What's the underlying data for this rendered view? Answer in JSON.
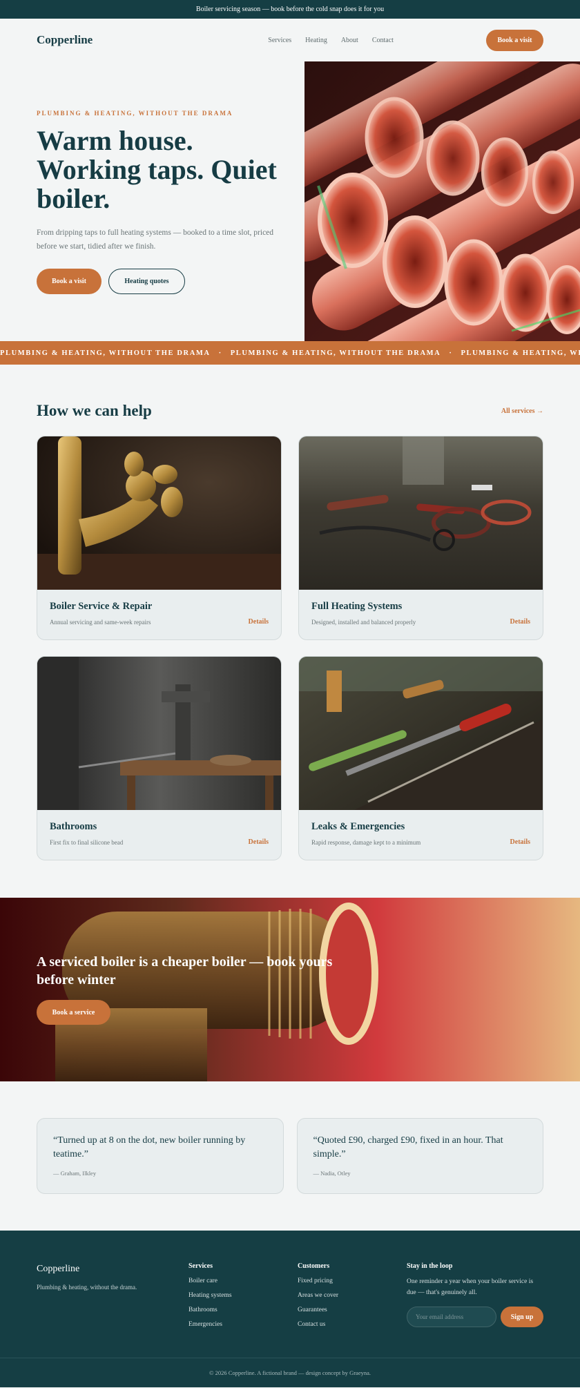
{
  "announcement": "Boiler servicing season — book before the cold snap does it for you",
  "header": {
    "logo": "Copperline",
    "nav": [
      "Services",
      "Heating",
      "About",
      "Contact"
    ],
    "cta": "Book a visit"
  },
  "hero": {
    "eyebrow": "PLUMBING & HEATING, WITHOUT THE DRAMA",
    "title": "Warm house. Working taps. Quiet boiler.",
    "subtitle": "From dripping taps to full heating systems — booked to a time slot, priced before we start, tidied after we finish.",
    "primary_cta": "Book a visit",
    "secondary_cta": "Heating quotes"
  },
  "ticker": {
    "text": "PLUMBING & HEATING, WITHOUT THE DRAMA",
    "separator": "·"
  },
  "services": {
    "title": "How we can help",
    "all_link": "All services →",
    "cards": [
      {
        "title": "Boiler Service & Repair",
        "desc": "Annual servicing and same-week repairs",
        "link": "Details"
      },
      {
        "title": "Full Heating Systems",
        "desc": "Designed, installed and balanced properly",
        "link": "Details"
      },
      {
        "title": "Bathrooms",
        "desc": "First fix to final silicone bead",
        "link": "Details"
      },
      {
        "title": "Leaks & Emergencies",
        "desc": "Rapid response, damage kept to a minimum",
        "link": "Details"
      }
    ]
  },
  "promo": {
    "title": "A serviced boiler is a cheaper boiler — book yours before winter",
    "cta": "Book a service"
  },
  "testimonials": [
    {
      "quote": "“Turned up at 8 on the dot, new boiler running by teatime.”",
      "author": "— Graham, Ilkley"
    },
    {
      "quote": "“Quoted £90, charged £90, fixed in an hour. That simple.”",
      "author": "— Nadia, Otley"
    }
  ],
  "footer": {
    "logo": "Copperline",
    "tagline": "Plumbing & heating, without the drama.",
    "services_head": "Services",
    "services_links": [
      "Boiler care",
      "Heating systems",
      "Bathrooms",
      "Emergencies"
    ],
    "customers_head": "Customers",
    "customers_links": [
      "Fixed pricing",
      "Areas we cover",
      "Guarantees",
      "Contact us"
    ],
    "newsletter_head": "Stay in the loop",
    "newsletter_text": "One reminder a year when your boiler service is due — that's genuinely all.",
    "email_placeholder": "Your email address",
    "signup": "Sign up",
    "copyright": "© 2026 Copperline. A fictional brand — design concept by Graeyna."
  },
  "colors": {
    "brand_teal": "#153e44",
    "accent_copper": "#c8723a",
    "page_bg": "#f3f5f5"
  }
}
